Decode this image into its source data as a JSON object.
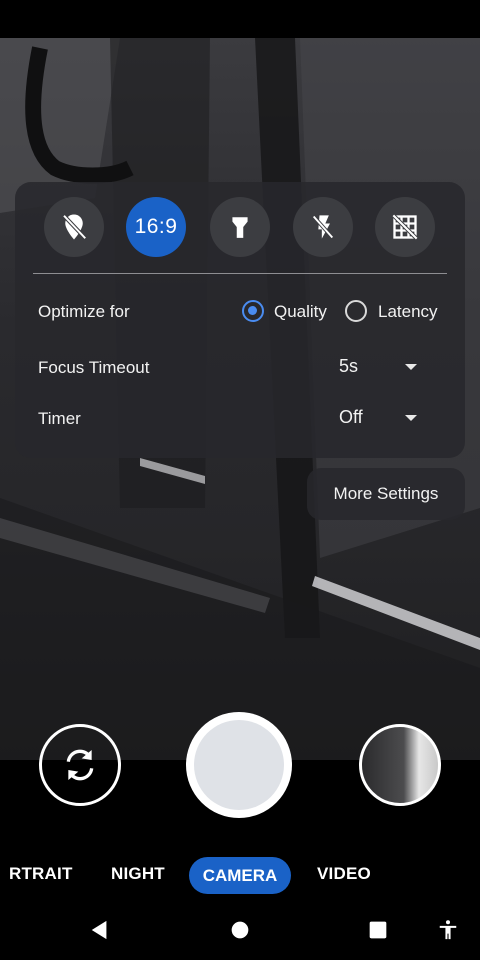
{
  "quick_settings": [
    {
      "icon": "location-off-icon",
      "active": false
    },
    {
      "icon": "aspect-ratio-icon",
      "label": "16:9",
      "active": true
    },
    {
      "icon": "flashlight-icon",
      "active": false
    },
    {
      "icon": "flash-off-icon",
      "active": false
    },
    {
      "icon": "grid-off-icon",
      "active": false
    }
  ],
  "settings": {
    "optimize_label": "Optimize for",
    "options": [
      {
        "label": "Quality",
        "selected": true
      },
      {
        "label": "Latency",
        "selected": false
      }
    ],
    "focus_label": "Focus Timeout",
    "focus_value": "5s",
    "timer_label": "Timer",
    "timer_value": "Off"
  },
  "more_settings_label": "More Settings",
  "modes": [
    "RTRAIT",
    "NIGHT",
    "CAMERA",
    "VIDEO"
  ],
  "selected_mode": "CAMERA",
  "colors": {
    "accent": "#1a62c7",
    "radio_accent": "#4a8cf0",
    "panel": "#28282c"
  }
}
